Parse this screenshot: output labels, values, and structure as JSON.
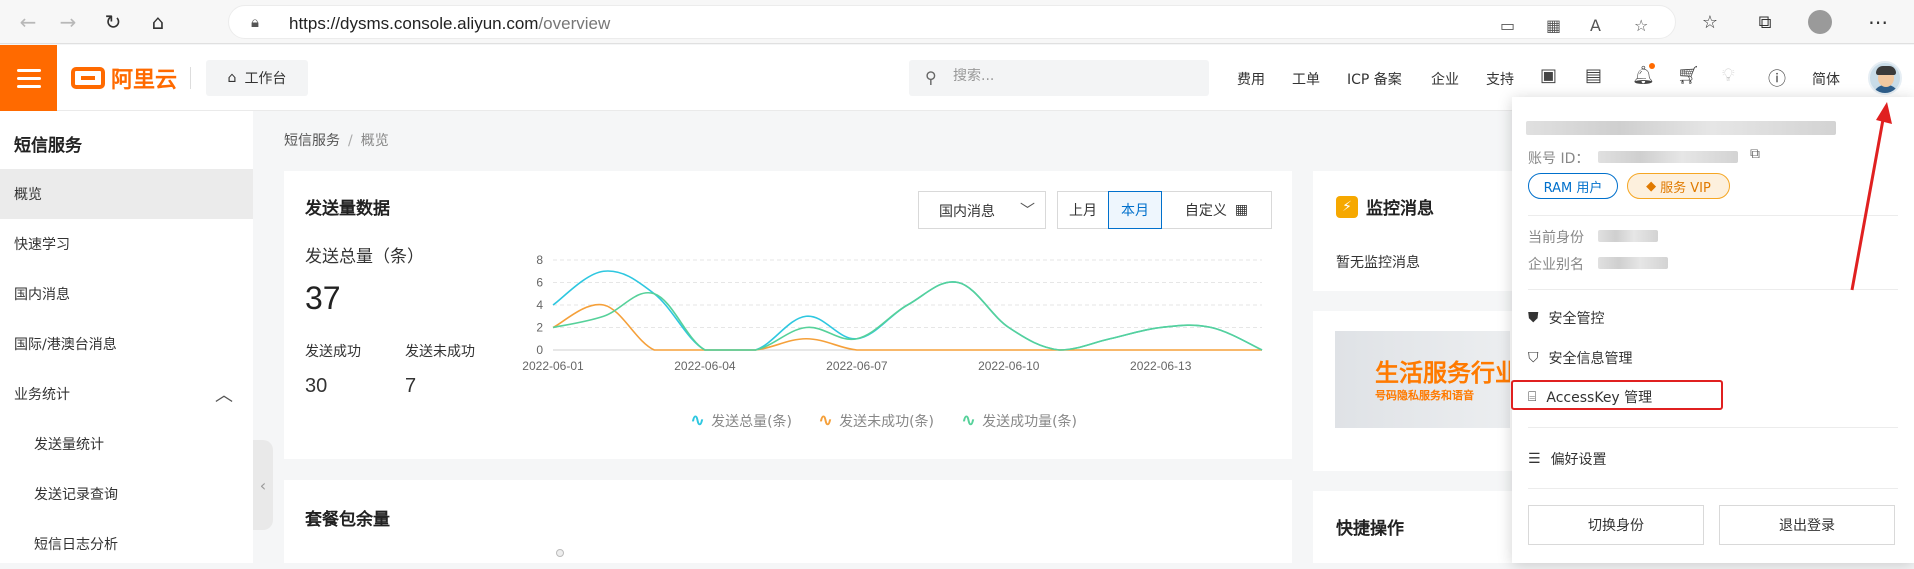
{
  "browser": {
    "url_host": "https://dysms.console.aliyun.com",
    "url_path": "/overview"
  },
  "topbar": {
    "logo_text": "阿里云",
    "workbench": "工作台",
    "search_placeholder": "搜索...",
    "links": [
      "费用",
      "工单",
      "ICP 备案",
      "企业",
      "支持"
    ],
    "lang": "简体",
    "accent": "#ff6a00"
  },
  "sidebar": {
    "title": "短信服务",
    "items": [
      "概览",
      "快速学习",
      "国内消息",
      "国际/港澳台消息",
      "业务统计",
      "发送量统计",
      "发送记录查询",
      "短信日志分析"
    ]
  },
  "breadcrumb": {
    "root": "短信服务",
    "current": "概览"
  },
  "send_card": {
    "title": "发送量数据",
    "dropdown": "国内消息",
    "ranges": [
      "上月",
      "本月",
      "自定义"
    ],
    "total_label": "发送总量（条）",
    "total_value": "37",
    "success_label": "发送成功",
    "success_value": "30",
    "fail_label": "发送未成功",
    "fail_value": "7"
  },
  "chart_data": {
    "type": "line",
    "x": [
      "2022-06-01",
      "2022-06-02",
      "2022-06-03",
      "2022-06-04",
      "2022-06-05",
      "2022-06-06",
      "2022-06-07",
      "2022-06-08",
      "2022-06-09",
      "2022-06-10",
      "2022-06-11",
      "2022-06-12",
      "2022-06-13",
      "2022-06-14",
      "2022-06-15"
    ],
    "x_tick_labels": [
      "2022-06-01",
      "2022-06-04",
      "2022-06-07",
      "2022-06-10",
      "2022-06-13"
    ],
    "y_tick_labels": [
      "0",
      "2",
      "4",
      "6",
      "8"
    ],
    "ylim": [
      0,
      8
    ],
    "grid": true,
    "legend_position": "bottom",
    "series": [
      {
        "name": "发送总量(条)",
        "color": "#2ec7e0",
        "values": [
          4,
          7,
          5,
          0,
          0,
          3,
          1,
          4,
          6,
          2,
          0,
          1,
          2,
          2,
          0
        ]
      },
      {
        "name": "发送未成功(条)",
        "color": "#f5a03a",
        "values": [
          2,
          4,
          0,
          0,
          0,
          1,
          0,
          0,
          0,
          0,
          0,
          0,
          0,
          0,
          0
        ]
      },
      {
        "name": "发送成功量(条)",
        "color": "#56d19a",
        "values": [
          2,
          3,
          5,
          0,
          0,
          2,
          1,
          4,
          6,
          2,
          0,
          1,
          2,
          2,
          0
        ]
      }
    ]
  },
  "package_card": {
    "title": "套餐包余量"
  },
  "monitor_card": {
    "title": "监控消息",
    "empty_text": "暂无监控消息"
  },
  "banner": {
    "headline": "生活服务行业",
    "sub": "号码隐私服务和语音"
  },
  "quick_card": {
    "title": "快捷操作"
  },
  "account_menu": {
    "account_id_label": "账号 ID：",
    "tag_ram": "RAM 用户",
    "tag_vip": "服务 VIP",
    "current_identity_label": "当前身份",
    "company_alias_label": "企业别名",
    "items": [
      "安全管控",
      "安全信息管理",
      "AccessKey 管理",
      "偏好设置"
    ],
    "btn_switch": "切换身份",
    "btn_logout": "退出登录"
  }
}
